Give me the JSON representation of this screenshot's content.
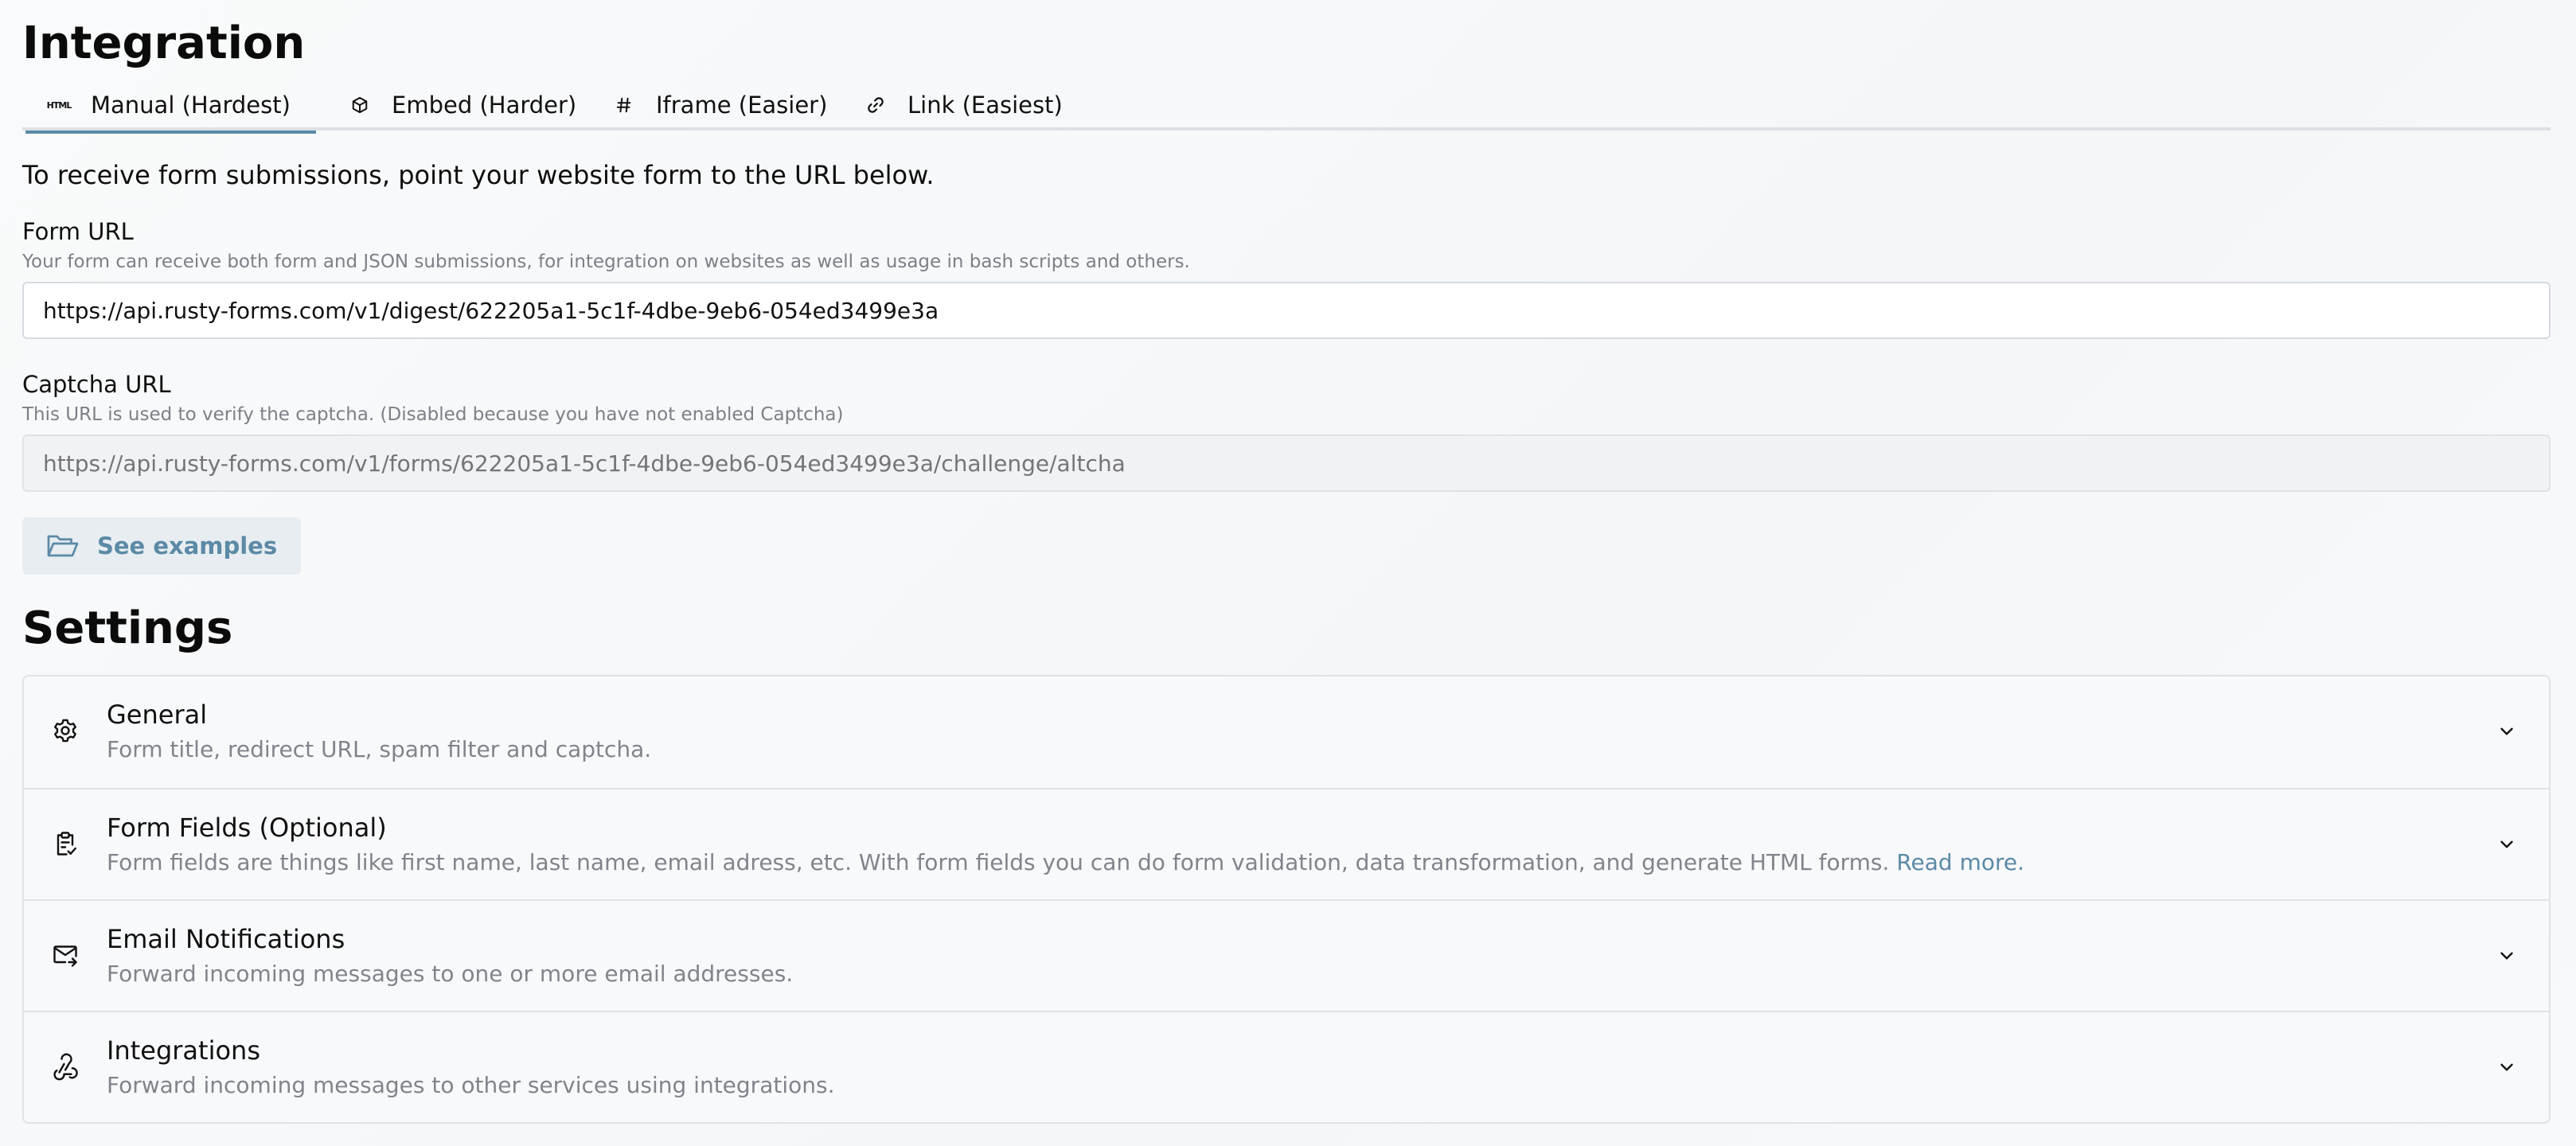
{
  "integration": {
    "title": "Integration",
    "tabs": [
      {
        "label": "Manual (Hardest)",
        "icon": "html-icon",
        "active": true
      },
      {
        "label": "Embed (Harder)",
        "icon": "cube-icon",
        "active": false
      },
      {
        "label": "Iframe (Easier)",
        "icon": "hash-icon",
        "active": false
      },
      {
        "label": "Link (Easiest)",
        "icon": "link-icon",
        "active": false
      }
    ],
    "intro": "To receive form submissions, point your website form to the URL below.",
    "form_url": {
      "label": "Form URL",
      "help": "Your form can receive both form and JSON submissions, for integration on websites as well as usage in bash scripts and others.",
      "value": "https://api.rusty-forms.com/v1/digest/622205a1-5c1f-4dbe-9eb6-054ed3499e3a"
    },
    "captcha_url": {
      "label": "Captcha URL",
      "help": "This URL is used to verify the captcha. (Disabled because you have not enabled Captcha)",
      "placeholder": "https://api.rusty-forms.com/v1/forms/622205a1-5c1f-4dbe-9eb6-054ed3499e3a/challenge/altcha",
      "disabled": true
    },
    "examples_button": {
      "label": "See examples",
      "icon": "folder-open-icon"
    }
  },
  "settings": {
    "title": "Settings",
    "items": [
      {
        "title": "General",
        "description": "Form title, redirect URL, spam filter and captcha.",
        "icon": "gear-icon"
      },
      {
        "title": "Form Fields (Optional)",
        "description": "Form fields are things like first name, last name, email adress, etc. With form fields you can do form validation, data transformation, and generate HTML forms.",
        "link": "Read more.",
        "icon": "clipboard-check-icon"
      },
      {
        "title": "Email Notifications",
        "description": "Forward incoming messages to one or more email addresses.",
        "icon": "mail-forward-icon"
      },
      {
        "title": "Integrations",
        "description": "Forward incoming messages to other services using integrations.",
        "icon": "webhook-icon"
      }
    ]
  },
  "colors": {
    "accent": "#5b8aa6",
    "muted_text": "#80848b",
    "border": "#dfe3e8"
  }
}
